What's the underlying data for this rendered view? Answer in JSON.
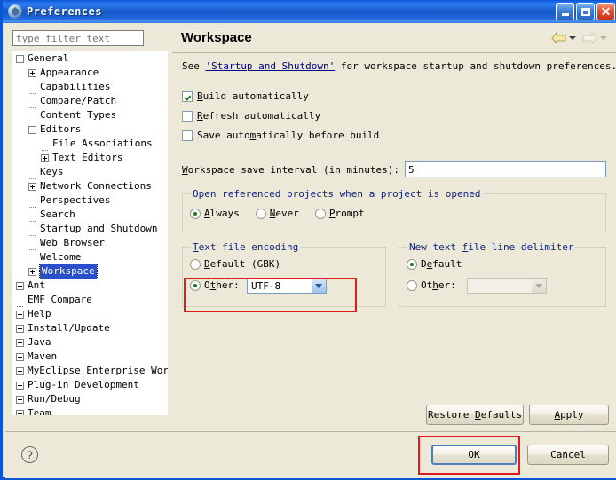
{
  "window": {
    "title": "Preferences",
    "icon": "eclipse-icon",
    "controls": {
      "minimize": "minimize-button",
      "maximize": "maximize-button",
      "close": "close-button"
    }
  },
  "sidebar": {
    "filter_placeholder": "type filter text",
    "filter_value": "",
    "tree": [
      {
        "label": "General",
        "indent": 0,
        "toggle": "minus",
        "selected": false
      },
      {
        "label": "Appearance",
        "indent": 1,
        "toggle": "plus",
        "selected": false
      },
      {
        "label": "Capabilities",
        "indent": 1,
        "toggle": "none",
        "selected": false
      },
      {
        "label": "Compare/Patch",
        "indent": 1,
        "toggle": "none",
        "selected": false
      },
      {
        "label": "Content Types",
        "indent": 1,
        "toggle": "none",
        "selected": false
      },
      {
        "label": "Editors",
        "indent": 1,
        "toggle": "minus",
        "selected": false
      },
      {
        "label": "File Associations",
        "indent": 2,
        "toggle": "none",
        "selected": false
      },
      {
        "label": "Text Editors",
        "indent": 2,
        "toggle": "plus",
        "selected": false
      },
      {
        "label": "Keys",
        "indent": 1,
        "toggle": "none",
        "selected": false
      },
      {
        "label": "Network Connections",
        "indent": 1,
        "toggle": "plus",
        "selected": false
      },
      {
        "label": "Perspectives",
        "indent": 1,
        "toggle": "none",
        "selected": false
      },
      {
        "label": "Search",
        "indent": 1,
        "toggle": "none",
        "selected": false
      },
      {
        "label": "Startup and Shutdown",
        "indent": 1,
        "toggle": "none",
        "selected": false
      },
      {
        "label": "Web Browser",
        "indent": 1,
        "toggle": "none",
        "selected": false
      },
      {
        "label": "Welcome",
        "indent": 1,
        "toggle": "none",
        "selected": false
      },
      {
        "label": "Workspace",
        "indent": 1,
        "toggle": "plus",
        "selected": true
      },
      {
        "label": "Ant",
        "indent": 0,
        "toggle": "plus",
        "selected": false
      },
      {
        "label": "EMF Compare",
        "indent": 0,
        "toggle": "none",
        "selected": false
      },
      {
        "label": "Help",
        "indent": 0,
        "toggle": "plus",
        "selected": false
      },
      {
        "label": "Install/Update",
        "indent": 0,
        "toggle": "plus",
        "selected": false
      },
      {
        "label": "Java",
        "indent": 0,
        "toggle": "plus",
        "selected": false
      },
      {
        "label": "Maven",
        "indent": 0,
        "toggle": "plus",
        "selected": false
      },
      {
        "label": "MyEclipse Enterprise Work",
        "indent": 0,
        "toggle": "plus",
        "selected": false
      },
      {
        "label": "Plug-in Development",
        "indent": 0,
        "toggle": "plus",
        "selected": false
      },
      {
        "label": "Run/Debug",
        "indent": 0,
        "toggle": "plus",
        "selected": false
      },
      {
        "label": "Team",
        "indent": 0,
        "toggle": "plus",
        "selected": false
      }
    ],
    "scroll_left_icon": "chevron-left-icon",
    "scroll_right_icon": "chevron-right-icon"
  },
  "page": {
    "title": "Workspace",
    "nav": {
      "back_icon": "arrow-back-icon",
      "back_dropdown_icon": "chevron-down-icon",
      "forward_icon": "arrow-forward-icon",
      "forward_dropdown_icon": "chevron-down-icon"
    },
    "lead_prefix": "See ",
    "lead_link": "'Startup and Shutdown'",
    "lead_suffix": " for workspace startup and shutdown preferences.",
    "checkboxes": [
      {
        "label": "Build automatically",
        "checked": true,
        "mnemonic": "B"
      },
      {
        "label": "Refresh automatically",
        "checked": false,
        "mnemonic": "R"
      },
      {
        "label": "Save automatically before build",
        "checked": false,
        "mnemonic": "m"
      }
    ],
    "save_interval": {
      "label": "Workspace save interval (in minutes):",
      "value": "5"
    },
    "open_referenced": {
      "group_label": "Open referenced projects when a project is opened",
      "options": [
        {
          "label": "Always",
          "selected": true
        },
        {
          "label": "Never",
          "selected": false
        },
        {
          "label": "Prompt",
          "selected": false
        }
      ]
    },
    "text_file_encoding": {
      "group_label": "Text file encoding",
      "default_label": "Default (GBK)",
      "default_selected": false,
      "other_label": "Other:",
      "other_selected": true,
      "other_value": "UTF-8"
    },
    "line_delimiter": {
      "group_label": "New text file line delimiter",
      "default_label": "Default",
      "default_selected": true,
      "other_label": "Other:",
      "other_selected": false,
      "other_value": "",
      "other_disabled": true
    },
    "restore_defaults_label": "Restore Defaults",
    "apply_label": "Apply"
  },
  "footer": {
    "help_icon": "help-icon",
    "ok_label": "OK",
    "cancel_label": "Cancel"
  },
  "annotations": {
    "highlight_color": "#e01b1b",
    "boxes": [
      "encoding-other-highlight",
      "ok-button-highlight"
    ]
  }
}
